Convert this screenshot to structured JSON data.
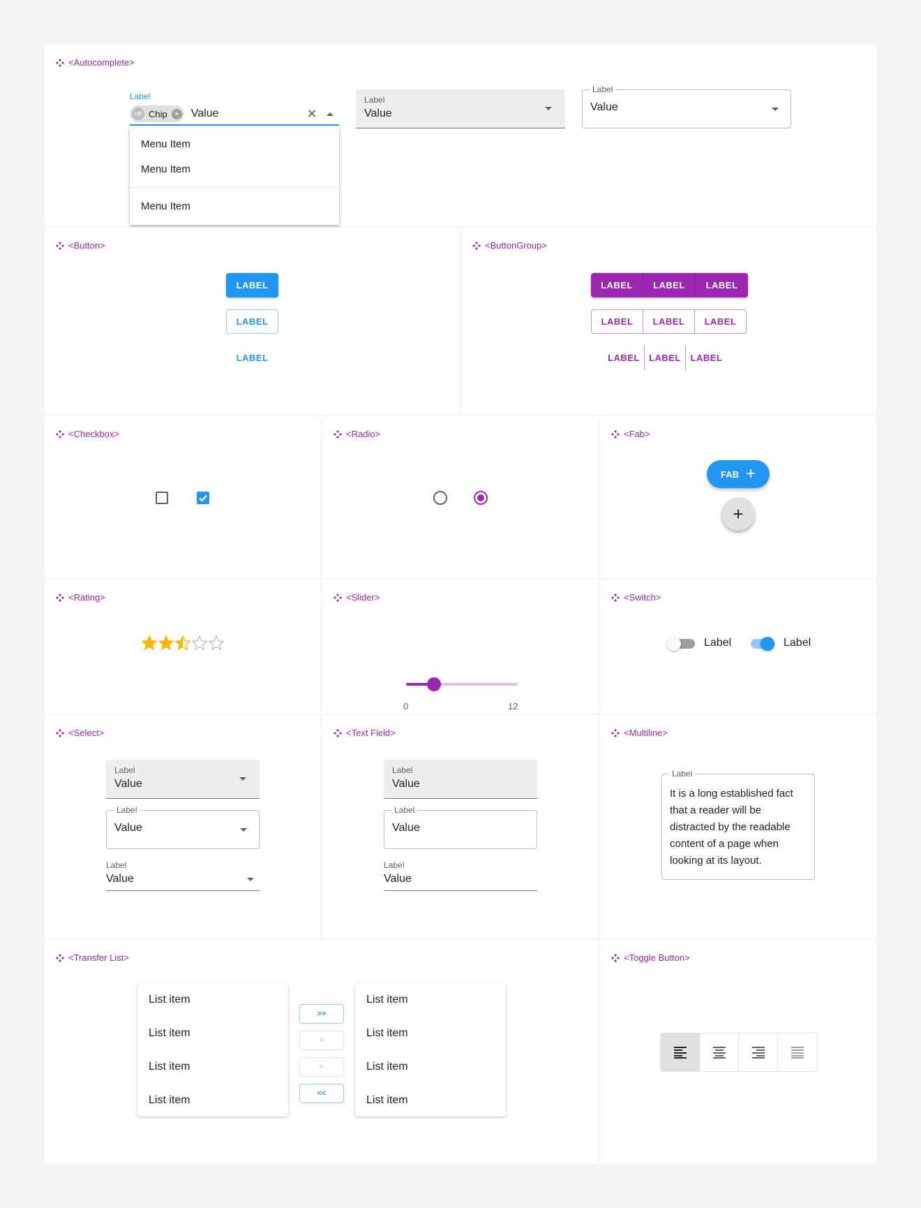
{
  "sections": {
    "autocomplete": "<Autocomplete>",
    "button": "<Button>",
    "button_group": "<ButtonGroup>",
    "checkbox": "<Checkbox>",
    "radio": "<Radio>",
    "fab": "<Fab>",
    "rating": "<Rating>",
    "slider": "<Slider>",
    "switch": "<Switch>",
    "select": "<Select>",
    "text_field": "<Text Field>",
    "multiline": "<Multiline>",
    "transfer_list": "<Transfer List>",
    "toggle_button": "<Toggle Button>"
  },
  "autocomplete": {
    "label": "Label",
    "chip_avatar": "OP",
    "chip_label": "Chip",
    "value": "Value",
    "menu_items": [
      "Menu Item",
      "Menu Item",
      "Menu Item"
    ],
    "filled": {
      "label": "Label",
      "value": "Value"
    },
    "outlined": {
      "label": "Label",
      "value": "Value"
    }
  },
  "buttons": {
    "contained": "LABEL",
    "outlined": "LABEL",
    "text": "LABEL"
  },
  "button_group": {
    "contained": [
      "LABEL",
      "LABEL",
      "LABEL"
    ],
    "outlined": [
      "LABEL",
      "LABEL",
      "LABEL"
    ],
    "text": [
      "LABEL",
      "LABEL",
      "LABEL"
    ]
  },
  "checkbox": {
    "unchecked": false,
    "checked": true
  },
  "radio": {
    "unselected": false,
    "selected": true
  },
  "fab": {
    "extended_label": "FAB",
    "plus": "+"
  },
  "rating": {
    "value": 2.5,
    "max": 5
  },
  "slider": {
    "min": 0,
    "max": 12,
    "value": 3,
    "min_label": "0",
    "max_label": "12"
  },
  "switch": {
    "off_label": "Label",
    "on_label": "Label",
    "off": false,
    "on": true
  },
  "select": {
    "filled": {
      "label": "Label",
      "value": "Value"
    },
    "outlined": {
      "label": "Label",
      "value": "Value"
    },
    "standard": {
      "label": "Label",
      "value": "Value"
    }
  },
  "text_field": {
    "filled": {
      "label": "Label",
      "value": "Value"
    },
    "outlined": {
      "label": "Label",
      "value": "Value"
    },
    "standard": {
      "label": "Label",
      "value": "Value"
    }
  },
  "multiline": {
    "label": "Label",
    "value": "It is a long established fact that a reader will be distracted by the readable content of a page when looking at its layout."
  },
  "transfer_list": {
    "left": [
      "List item",
      "List item",
      "List item",
      "List item"
    ],
    "right": [
      "List item",
      "List item",
      "List item",
      "List item"
    ],
    "buttons": [
      ">>",
      ">",
      "<",
      "<<"
    ]
  },
  "toggle_button": {
    "options": [
      "align-left-icon",
      "align-center-icon",
      "align-right-icon",
      "align-justify-icon"
    ],
    "selected": 0
  },
  "colors": {
    "primary": "#2196f3",
    "secondary": "#9c27b0",
    "star": "#ffb400",
    "background": "#f5f5f5"
  }
}
